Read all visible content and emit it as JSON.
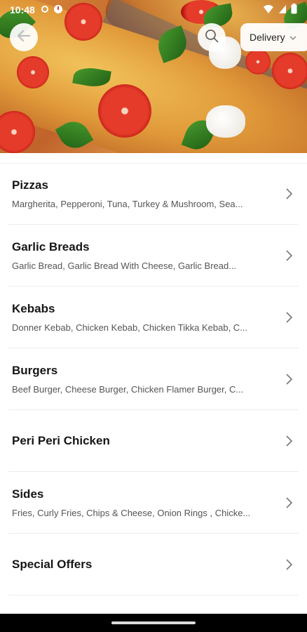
{
  "status_bar": {
    "time": "10:48"
  },
  "header": {
    "back_icon": "arrow-left-icon",
    "search_icon": "search-icon",
    "order_mode": "Delivery",
    "order_mode_icon": "chevron-down-icon"
  },
  "categories": [
    {
      "title": "Pizzas",
      "description": "Margherita, Pepperoni, Tuna, Turkey & Mushroom, Sea..."
    },
    {
      "title": "Garlic Breads",
      "description": "Garlic Bread, Garlic Bread With Cheese, Garlic Bread..."
    },
    {
      "title": "Kebabs",
      "description": "Donner Kebab, Chicken Kebab, Chicken Tikka Kebab, C..."
    },
    {
      "title": "Burgers",
      "description": "Beef Burger, Cheese Burger, Chicken Flamer Burger, C..."
    },
    {
      "title": "Peri Peri Chicken",
      "description": ""
    },
    {
      "title": "Sides",
      "description": "Fries, Curly Fries, Chips & Cheese, Onion Rings , Chicke..."
    },
    {
      "title": "Special Offers",
      "description": ""
    }
  ],
  "colors": {
    "text_primary": "#161616",
    "text_secondary": "#555555",
    "divider": "#ededed"
  }
}
